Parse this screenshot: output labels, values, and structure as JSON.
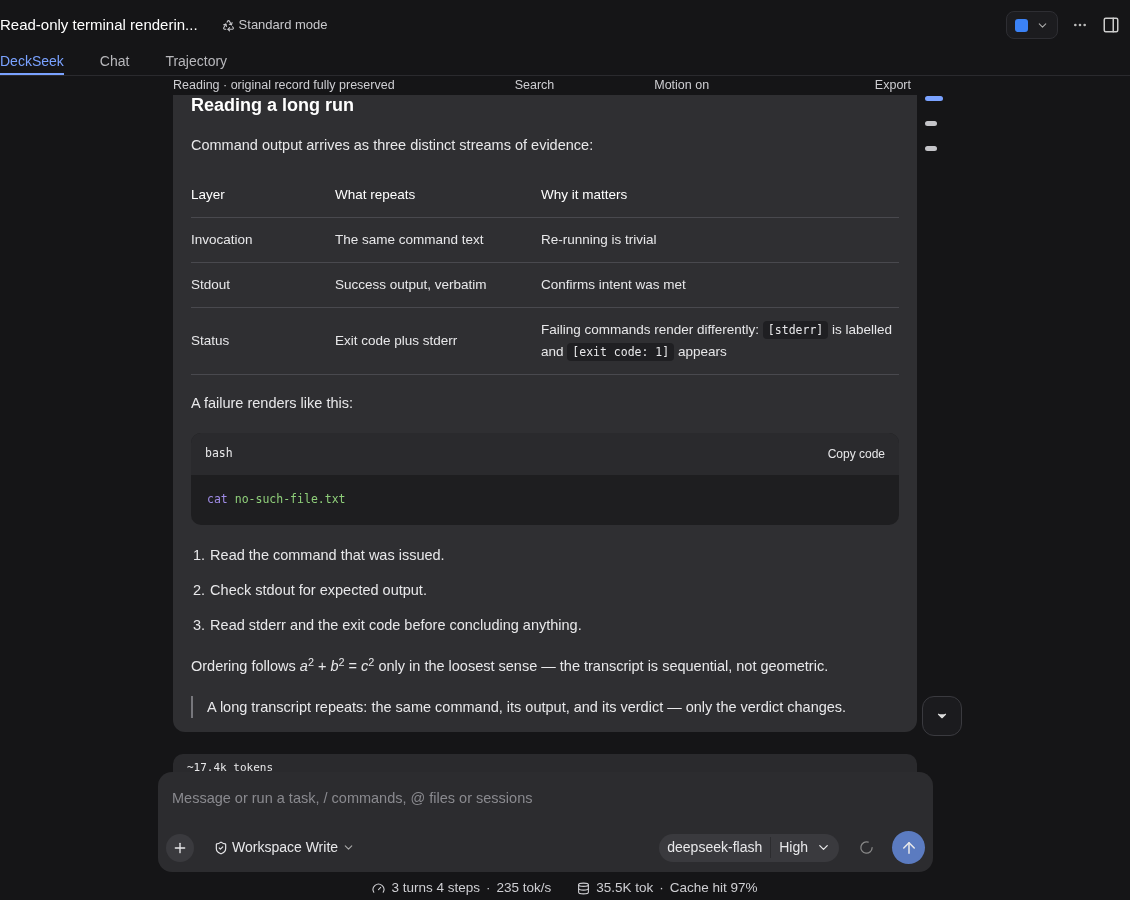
{
  "header": {
    "title": "Read-only terminal renderin...",
    "mode": "Standard mode"
  },
  "tabs": [
    {
      "label": "DeckSeek",
      "selected": true
    },
    {
      "label": "Chat",
      "selected": false
    },
    {
      "label": "Trajectory",
      "selected": false
    }
  ],
  "reading_bar": {
    "status": "Reading · original record fully preserved",
    "search": "Search",
    "motion": "Motion on",
    "export": "Export"
  },
  "minimap": [
    {
      "selected": true
    },
    {
      "selected": false
    },
    {
      "selected": false
    }
  ],
  "article": {
    "heading": "Reading a long run",
    "intro": "Command output arrives as three distinct streams of evidence:",
    "table": {
      "columns": [
        "Layer",
        "What repeats",
        "Why it matters"
      ],
      "rows": [
        {
          "cells": [
            "Invocation",
            "The same command text",
            [
              {
                "kind": "text",
                "text": "Re-running is trivial"
              }
            ]
          ]
        },
        {
          "cells": [
            "Stdout",
            "Success output, verbatim",
            [
              {
                "kind": "text",
                "text": "Confirms intent was met"
              }
            ]
          ]
        },
        {
          "cells": [
            "Status",
            "Exit code plus stderr",
            [
              {
                "kind": "text",
                "text": "Failing commands render differently: "
              },
              {
                "kind": "code",
                "text": "[stderr]"
              },
              {
                "kind": "text",
                "text": " is labelled and "
              },
              {
                "kind": "code",
                "text": "[exit code: 1]"
              },
              {
                "kind": "text",
                "text": " appears"
              }
            ]
          ]
        }
      ]
    },
    "failure_intro": "A failure renders like this:",
    "code_block": {
      "language": "bash",
      "copy": "Copy code",
      "command": "cat",
      "argument": "no-such-file.txt"
    },
    "steps": [
      {
        "number": "1.",
        "text": "Read the command that was issued."
      },
      {
        "number": "2.",
        "text": "Check stdout for expected output."
      },
      {
        "number": "3.",
        "text": "Read stderr and the exit code before concluding anything."
      }
    ],
    "ordering": "Ordering follows *a*$^{2}$ + *b*$^{2}$ = *c*$^{2}$ only in the loosest sense — the transcript is sequential, not geometric.",
    "quote": "A long transcript repeats: the same command, its output, and its verdict — only the verdict changes."
  },
  "token_card": {
    "text": "~17.4k tokens"
  },
  "composer": {
    "placeholder": "Message or run a task, / commands, @ files or sessions",
    "permission": "Workspace Write",
    "model": "deepseek-flash",
    "effort": "High"
  },
  "footer": {
    "turns": "3 turns 4 steps",
    "separator_1": "·",
    "speed": "235 tok/s",
    "tokens": "35.5K tok",
    "separator_2": "·",
    "cache": "Cache hit 97%"
  }
}
